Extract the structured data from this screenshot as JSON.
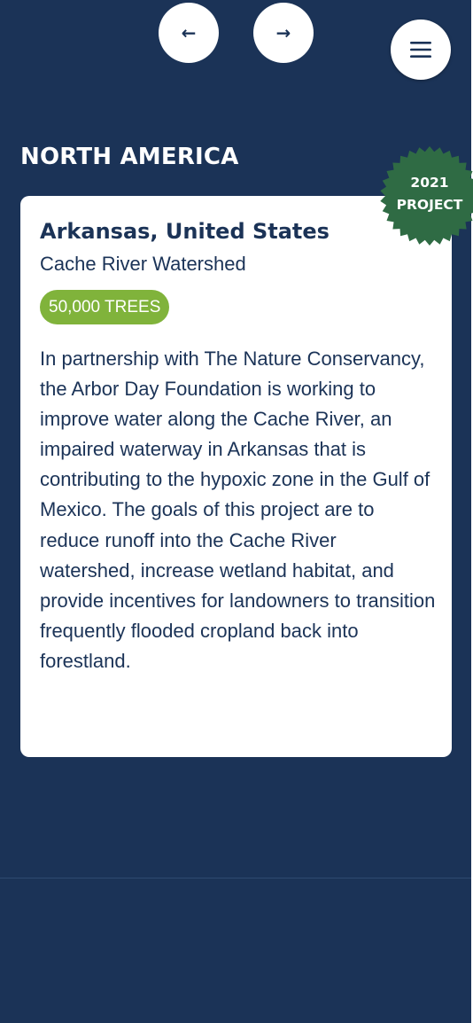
{
  "navigation": {
    "prev_arrow": "←",
    "next_arrow": "→",
    "menu_icon": "hamburger-menu-icon"
  },
  "region": {
    "title": "NORTH AMERICA"
  },
  "project": {
    "seal_year": "2021",
    "seal_label": "PROJECT",
    "location": "Arkansas, United States",
    "site": "Cache River Watershed",
    "trees_badge": "50,000 TREES",
    "description": "In partnership with The Nature Conservancy, the Arbor Day Foundation is working to improve water along the Cache River, an impaired waterway in Arkansas that is contributing to the hypoxic zone in the Gulf of Mexico. The goals of this project are to reduce runoff into the Cache River watershed, increase wetland habitat, and provide incentives for landowners to transition frequently flooded cropland back into forestland."
  },
  "colors": {
    "background": "#1b3357",
    "card": "#ffffff",
    "text_navy": "#1b3357",
    "badge_green": "#80b33b",
    "seal_green": "#2f6b44"
  }
}
